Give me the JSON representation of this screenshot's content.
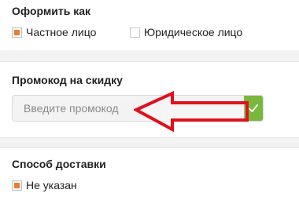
{
  "order_as": {
    "title": "Оформить как",
    "options": [
      {
        "label": "Частное лицо",
        "checked": true
      },
      {
        "label": "Юридическое лицо",
        "checked": false
      }
    ]
  },
  "promo": {
    "title": "Промокод на скидку",
    "placeholder": "Введите промокод",
    "value": ""
  },
  "delivery": {
    "title": "Способ доставки",
    "options": [
      {
        "label": "Не указан",
        "checked": true
      }
    ]
  },
  "colors": {
    "accent": "#ee7d2a",
    "apply_button": "#79b83c",
    "annotation": "#e0101c"
  },
  "icons": {
    "apply": "check-icon",
    "annotation": "arrow-left-icon"
  }
}
